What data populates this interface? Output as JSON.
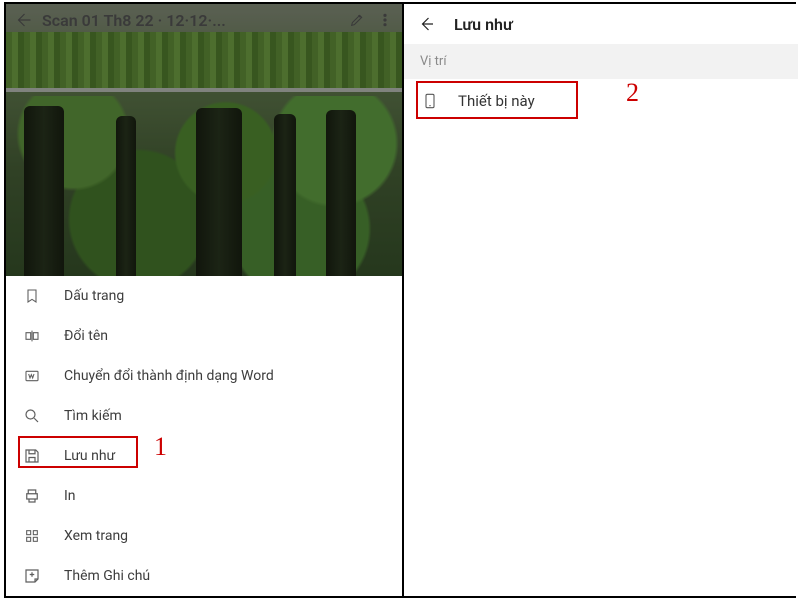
{
  "left": {
    "header": {
      "title": "Scan 01 Th8 22 · 12·12·..."
    },
    "menu": [
      {
        "label": "Dấu trang"
      },
      {
        "label": "Đổi tên"
      },
      {
        "label": "Chuyển đổi thành định dạng Word"
      },
      {
        "label": "Tìm kiếm"
      },
      {
        "label": "Lưu như"
      },
      {
        "label": "In"
      },
      {
        "label": "Xem trang"
      },
      {
        "label": "Thêm Ghi chú"
      }
    ],
    "annotation": "1"
  },
  "right": {
    "title": "Lưu như",
    "section_label": "Vị trí",
    "location_option": "Thiết bị này",
    "annotation": "2"
  },
  "colors": {
    "highlight": "#cc0000"
  }
}
